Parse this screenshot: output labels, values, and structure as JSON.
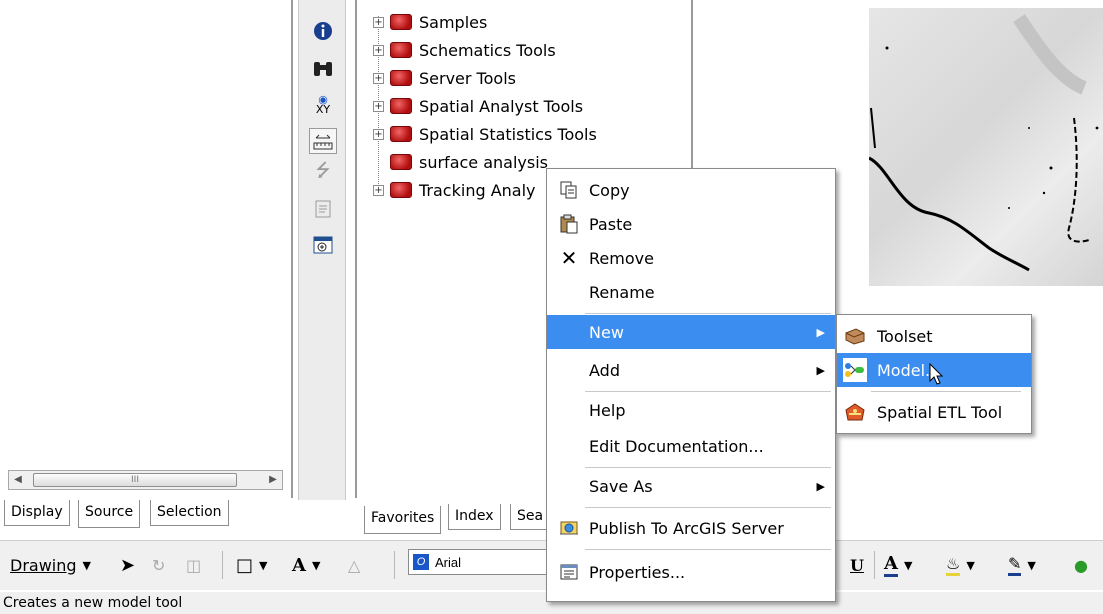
{
  "toc": {
    "scroll_thumb_grip": "III",
    "tabs": [
      "Display",
      "Source",
      "Selection"
    ]
  },
  "catalog": {
    "tree": [
      {
        "label": "Samples",
        "expandable": true
      },
      {
        "label": "Schematics Tools",
        "expandable": true
      },
      {
        "label": "Server Tools",
        "expandable": true
      },
      {
        "label": "Spatial Analyst Tools",
        "expandable": true
      },
      {
        "label": "Spatial Statistics Tools",
        "expandable": true
      },
      {
        "label": "surface analysis",
        "expandable": false
      },
      {
        "label": "Tracking Analy",
        "expandable": true
      }
    ],
    "tabs": [
      "Favorites",
      "Index",
      "Sea"
    ]
  },
  "context_menu": {
    "items": [
      {
        "label": "Copy",
        "icon": "copy-icon"
      },
      {
        "label": "Paste",
        "icon": "paste-icon"
      },
      {
        "label": "Remove",
        "icon": "remove-icon"
      },
      {
        "label": "Rename",
        "icon": ""
      },
      {
        "label": "New",
        "icon": "",
        "submenu": true,
        "highlighted": true
      },
      {
        "label": "Add",
        "icon": "",
        "submenu": true
      },
      {
        "label": "Help",
        "icon": ""
      },
      {
        "label": "Edit Documentation...",
        "icon": ""
      },
      {
        "label": "Save As",
        "icon": "",
        "submenu": true
      },
      {
        "label": "Publish To ArcGIS Server",
        "icon": "publish-icon"
      },
      {
        "label": "Properties...",
        "icon": "properties-icon"
      }
    ]
  },
  "submenu_new": {
    "items": [
      {
        "label": "Toolset",
        "icon": "toolset-icon"
      },
      {
        "label": "Model...",
        "icon": "model-icon",
        "highlighted": true
      },
      {
        "label": "Spatial ETL Tool",
        "icon": "spatial-etl-icon"
      }
    ]
  },
  "drawing_toolbar": {
    "drawing_label": "Drawing",
    "font_name": "Arial",
    "underline_label": "U"
  },
  "status_bar": {
    "text": "Creates a new model tool"
  },
  "colors": {
    "menu_highlight": "#3b8ef0",
    "toolbox_red": "#c0392b"
  }
}
